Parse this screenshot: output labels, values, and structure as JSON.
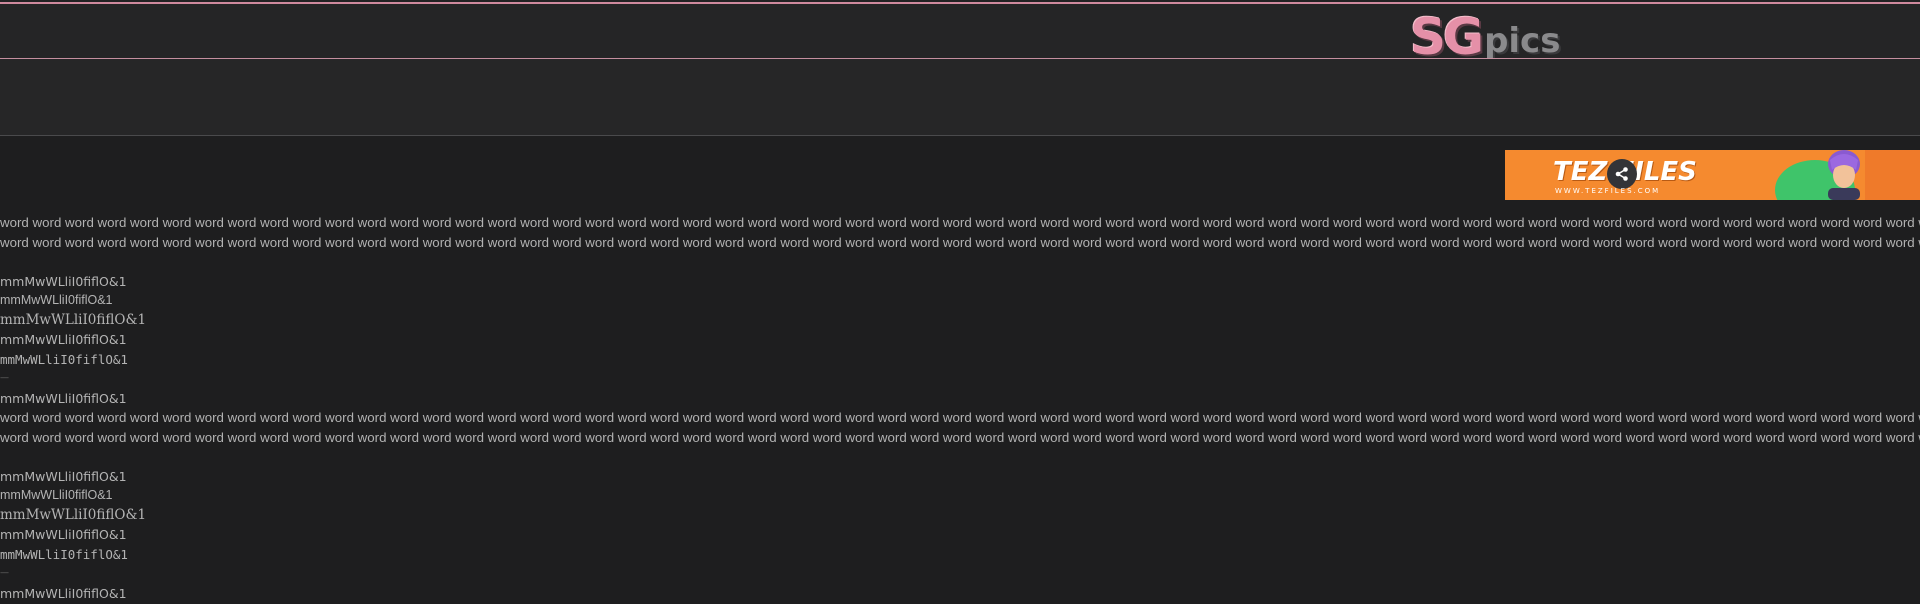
{
  "header": {
    "logo_primary": "SG",
    "logo_secondary": "pics"
  },
  "banner": {
    "brand": "TEZ FILES",
    "url": "WWW.TEZFILES.COM",
    "share_icon": "share-icon"
  },
  "content": {
    "word_line": "word word word word word word word word word word word word word word word word word word word word word word word word word word word word word word word word word word word word word word word word word word word word word word word word word word word word word word word word word word word word word word word word word word word word word word word word word word word word word",
    "glyph_lines": [
      "mmMwWLliI0fiflO&1",
      "mmMwWLliI0fiflO&1",
      "mmMwWLliI0fiflO&1",
      "mmMwWLliI0fiflO&1",
      "mmMwWLliI0fiflO&1"
    ],
    "dash": "—",
    "glyph_after": "mmMwWLliI0fiflO&1"
  },
  "colors": {
    "background": "#1e1e1f",
    "accent_pink": "#e590a8",
    "banner_orange": "#f58a2f",
    "banner_green": "#3fc46a"
  }
}
